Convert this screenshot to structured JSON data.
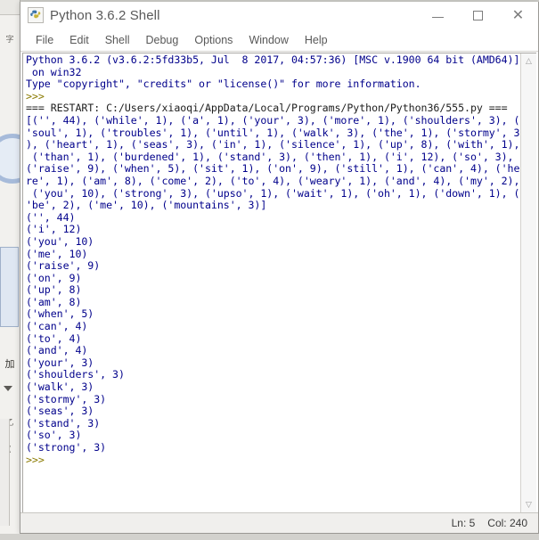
{
  "window": {
    "title": "Python 3.6.2 Shell",
    "icon": "python-idle-icon",
    "controls": {
      "minimize": "minimize-icon",
      "maximize": "maximize-icon",
      "close": "close-icon"
    }
  },
  "menubar": {
    "items": [
      {
        "label": "File"
      },
      {
        "label": "Edit"
      },
      {
        "label": "Shell"
      },
      {
        "label": "Debug"
      },
      {
        "label": "Options"
      },
      {
        "label": "Window"
      },
      {
        "label": "Help"
      }
    ]
  },
  "console": {
    "startup_lines": [
      "Python 3.6.2 (v3.6.2:5fd33b5, Jul  8 2017, 04:57:36) [MSC v.1900 64 bit (AMD64)]",
      " on win32",
      "Type \"copyright\", \"credits\" or \"license()\" for more information."
    ],
    "prompt": ">>>",
    "restart_line": "=== RESTART: C:/Users/xiaoqi/AppData/Local/Programs/Python/Python36/555.py ===",
    "output_block_1": [
      "[('', 44), ('while', 1), ('a', 1), ('your', 3), ('more', 1), ('shoulders', 3), (",
      "'soul', 1), ('troubles', 1), ('until', 1), ('walk', 3), ('the', 1), ('stormy', 3",
      "), ('heart', 1), ('seas', 3), ('in', 1), ('silence', 1), ('up', 8), ('with', 1),",
      " ('than', 1), ('burdened', 1), ('stand', 3), ('then', 1), ('i', 12), ('so', 3),",
      "('raise', 9), ('when', 5), ('sit', 1), ('on', 9), ('still', 1), ('can', 4), ('he",
      "re', 1), ('am', 8), ('come', 2), ('to', 4), ('weary', 1), ('and', 4), ('my', 2),",
      " ('you', 10), ('strong', 3), ('upso', 1), ('wait', 1), ('oh', 1), ('down', 1), (",
      "'be', 2), ('me', 10), ('mountains', 3)]"
    ],
    "output_block_2": [
      "('', 44)",
      "('i', 12)",
      "('you', 10)",
      "('me', 10)",
      "('raise', 9)",
      "('on', 9)",
      "('up', 8)",
      "('am', 8)",
      "('when', 5)",
      "('can', 4)",
      "('to', 4)",
      "('and', 4)",
      "('your', 3)",
      "('shoulders', 3)",
      "('walk', 3)",
      "('stormy', 3)",
      "('seas', 3)",
      "('stand', 3)",
      "('so', 3)",
      "('strong', 3)"
    ],
    "final_prompt": ">>>"
  },
  "scrollbar": {
    "up_arrow": "chevron-up-icon",
    "down_arrow": "chevron-down-icon"
  },
  "statusbar": {
    "line": "Ln: 5",
    "col": "Col: 240"
  },
  "colors": {
    "startup_text": "#00008b",
    "prompt_text": "#8a7a00",
    "restart_text": "#202020",
    "output_text": "#00008b",
    "window_bg": "#ffffff",
    "statusbar_bg": "#f0efed"
  }
}
